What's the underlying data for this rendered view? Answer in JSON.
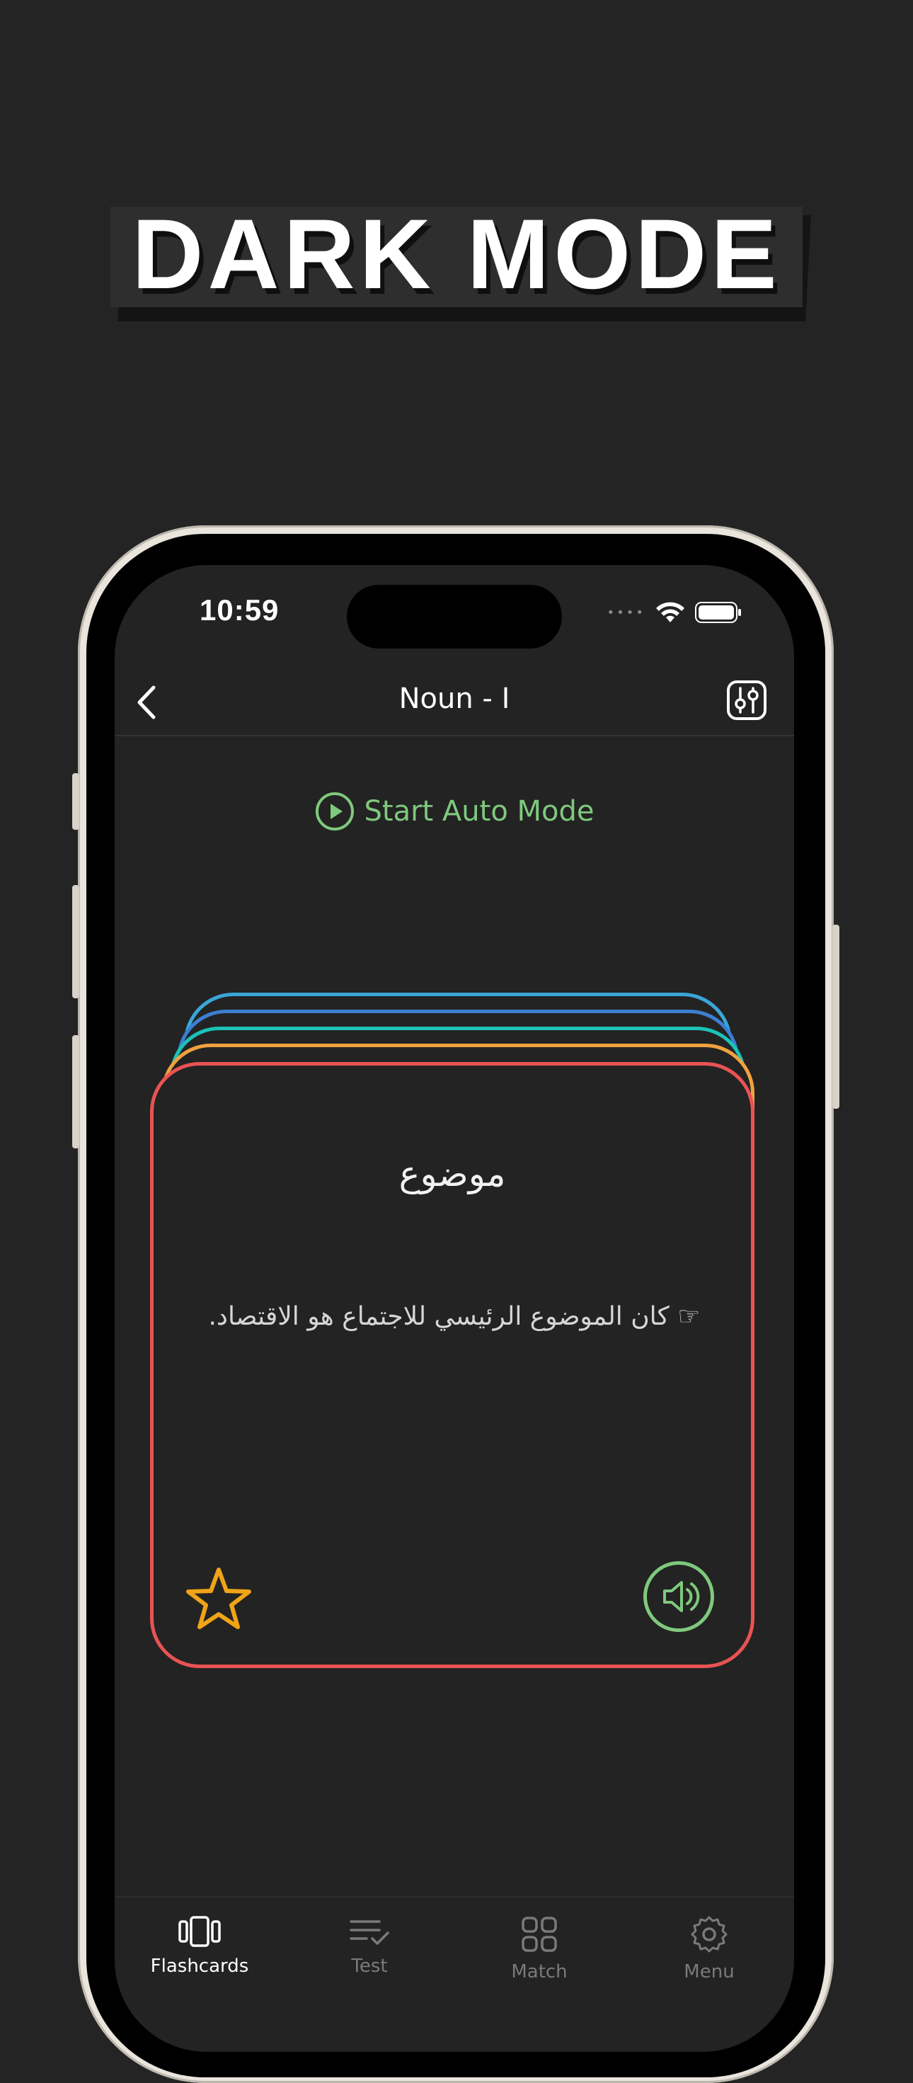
{
  "headline": "DARK MODE",
  "status": {
    "time": "10:59"
  },
  "nav": {
    "title": "Noun - I"
  },
  "auto_mode": {
    "label": "Start Auto Mode"
  },
  "card": {
    "word": "موضوع",
    "example": "☞  كان الموضوع الرئيسي للاجتماع هو الاقتصاد."
  },
  "tabs": [
    {
      "label": "Flashcards",
      "icon": "flashcards-icon",
      "active": true
    },
    {
      "label": "Test",
      "icon": "test-checklist-icon",
      "active": false
    },
    {
      "label": "Match",
      "icon": "match-grid-icon",
      "active": false
    },
    {
      "label": "Menu",
      "icon": "gear-icon",
      "active": false
    }
  ],
  "colors": {
    "background": "#242424",
    "accent_green": "#7fc97d",
    "card_red": "#e95353",
    "star_orange": "#f0a417",
    "layer_blue": "#3aa6d8",
    "layer_navy": "#3c7fd1",
    "layer_teal": "#1cc2b8",
    "layer_orange": "#f0a240"
  }
}
